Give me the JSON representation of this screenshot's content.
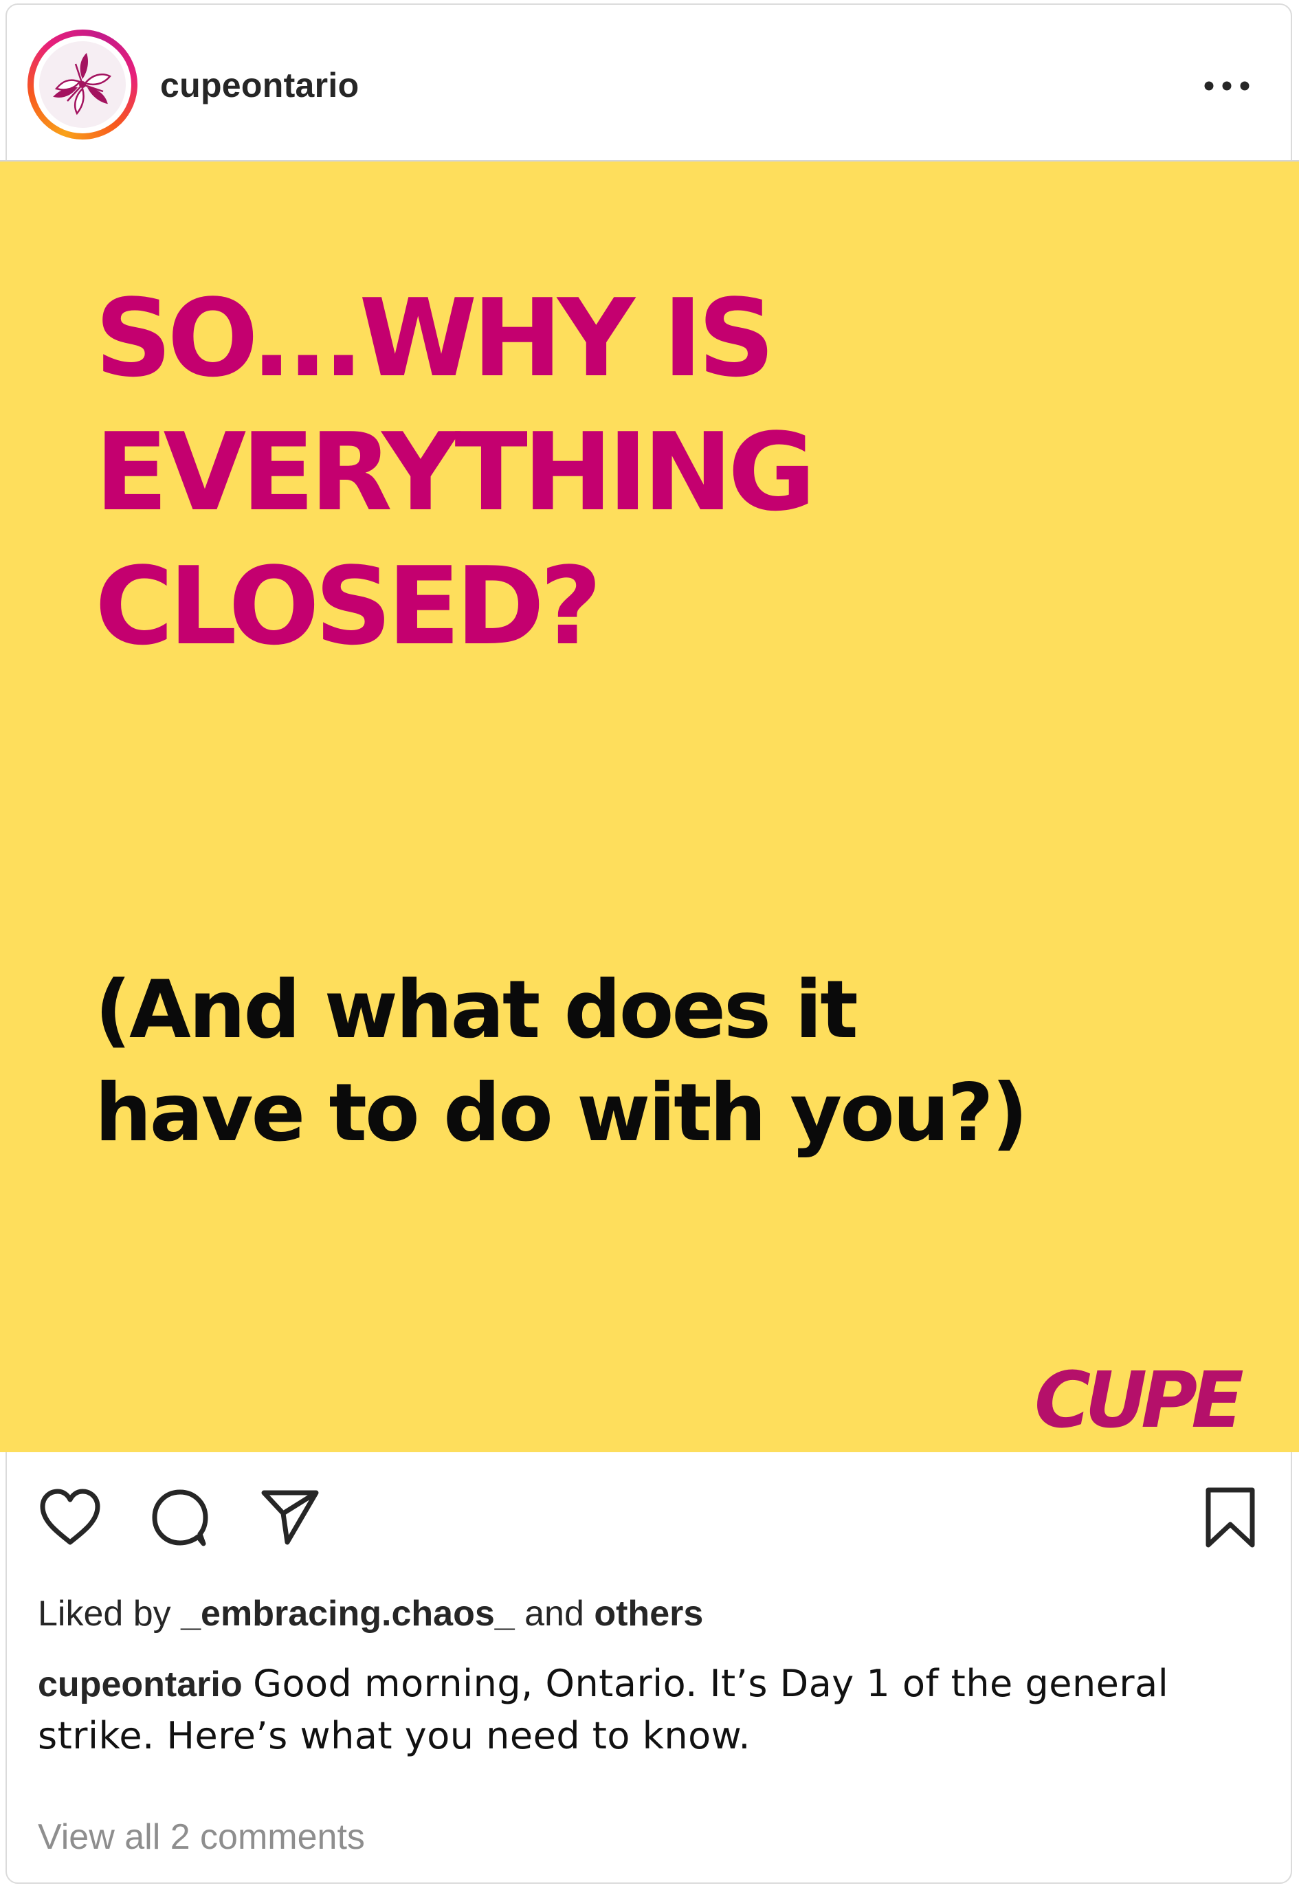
{
  "header": {
    "username": "cupeontario",
    "avatar_icon": "trillium-logo-icon",
    "more_icon": "more-options-icon"
  },
  "post": {
    "headline_lines": [
      "SO...WHY IS",
      "EVERYTHING",
      "CLOSED?"
    ],
    "subhead_lines": [
      "(And what does it",
      "have to do with you?)"
    ],
    "logo_text": "CUPE",
    "background_color": "#fede5c",
    "headline_color": "#c4006f",
    "subhead_color": "#0a0a0a",
    "logo_color": "#b5106a"
  },
  "actions": {
    "like_icon": "heart-icon",
    "comment_icon": "comment-icon",
    "share_icon": "share-icon",
    "save_icon": "bookmark-icon"
  },
  "likes": {
    "prefix": "Liked by ",
    "first_user": "_embracing.chaos_",
    "middle": " and ",
    "others": "others"
  },
  "caption": {
    "username": "cupeontario",
    "text": "Good morning, Ontario. It’s Day 1 of the general strike. Here’s what you need to know."
  },
  "comments": {
    "view_all": "View all 2 comments"
  }
}
